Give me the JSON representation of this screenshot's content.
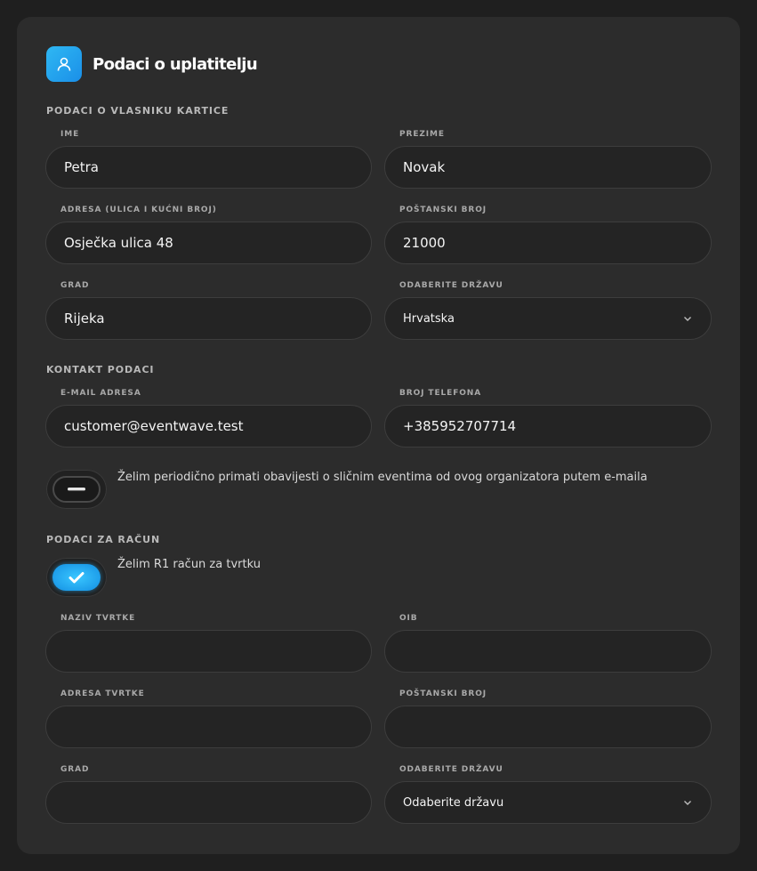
{
  "header": {
    "title": "Podaci o uplatitelju",
    "icon": "user-icon",
    "accent": "#25A8F0"
  },
  "cardholder": {
    "section_title": "PODACI O VLASNIKU KARTICE",
    "first_name": {
      "label": "IME",
      "value": "Petra"
    },
    "last_name": {
      "label": "PREZIME",
      "value": "Novak"
    },
    "address": {
      "label": "ADRESA (ULICA I KUĆNI BROJ)",
      "value": "Osječka ulica 48"
    },
    "postal_code": {
      "label": "POŠTANSKI BROJ",
      "value": "21000"
    },
    "city": {
      "label": "GRAD",
      "value": "Rijeka"
    },
    "country": {
      "label": "ODABERITE DRŽAVU",
      "value": "Hrvatska"
    }
  },
  "contact": {
    "section_title": "KONTAKT PODACI",
    "email": {
      "label": "E-MAIL ADRESA",
      "value": "customer@eventwave.test"
    },
    "phone": {
      "label": "BROJ TELEFONA",
      "value": "+385952707714"
    },
    "newsletter": {
      "text": "Želim periodično primati obavijesti o sličnim eventima od ovog organizatora putem e-maila",
      "checked": false
    }
  },
  "invoice": {
    "section_title": "PODACI ZA RAČUN",
    "r1": {
      "text": "Želim R1 račun za tvrtku",
      "checked": true
    },
    "company_name": {
      "label": "NAZIV TVRTKE",
      "value": ""
    },
    "oib": {
      "label": "OIB",
      "value": ""
    },
    "company_address": {
      "label": "ADRESA TVRTKE",
      "value": ""
    },
    "postal_code": {
      "label": "POŠTANSKI BROJ",
      "value": ""
    },
    "city": {
      "label": "GRAD",
      "value": ""
    },
    "country": {
      "label": "ODABERITE DRŽAVU",
      "value": "Odaberite državu"
    }
  }
}
